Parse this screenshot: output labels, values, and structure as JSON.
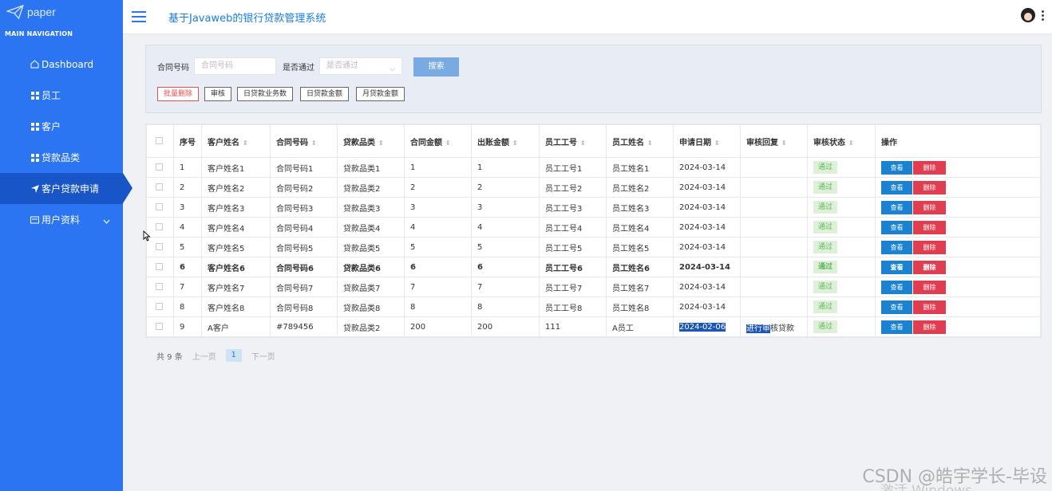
{
  "sidebar": {
    "logo_text": "paper",
    "nav_header": "MAIN NAVIGATION",
    "items": [
      {
        "label": "Dashboard"
      },
      {
        "label": "员工"
      },
      {
        "label": "客户"
      },
      {
        "label": "贷款品类"
      },
      {
        "label": "客户贷款申请"
      },
      {
        "label": "用户资料"
      }
    ]
  },
  "header": {
    "title": "基于Javaweb的银行贷款管理系统"
  },
  "search": {
    "contract_label": "合同号码",
    "contract_placeholder": "合同号码",
    "passed_label": "是否通过",
    "passed_placeholder": "是否通过",
    "search_button": "搜索"
  },
  "actions": {
    "batch_delete": "批量删除",
    "review": "审核",
    "daily_count": "日贷款业务数",
    "daily_amount": "日贷款金额",
    "monthly_amount": "月贷款金额"
  },
  "table": {
    "headers": [
      "序号",
      "客户姓名",
      "合同号码",
      "贷款品类",
      "合同金额",
      "出账金额",
      "员工工号",
      "员工姓名",
      "申请日期",
      "审核回复",
      "审核状态",
      "操作"
    ],
    "rows": [
      {
        "no": "1",
        "customer": "客户姓名1",
        "contract": "合同号码1",
        "category": "贷款品类1",
        "amount": "1",
        "out": "1",
        "emp_no": "员工工号1",
        "emp_name": "员工姓名1",
        "date": "2024-03-14",
        "reply": "",
        "status": "通过"
      },
      {
        "no": "2",
        "customer": "客户姓名2",
        "contract": "合同号码2",
        "category": "贷款品类2",
        "amount": "2",
        "out": "2",
        "emp_no": "员工工号2",
        "emp_name": "员工姓名2",
        "date": "2024-03-14",
        "reply": "",
        "status": "通过"
      },
      {
        "no": "3",
        "customer": "客户姓名3",
        "contract": "合同号码3",
        "category": "贷款品类3",
        "amount": "3",
        "out": "3",
        "emp_no": "员工工号3",
        "emp_name": "员工姓名3",
        "date": "2024-03-14",
        "reply": "",
        "status": "通过"
      },
      {
        "no": "4",
        "customer": "客户姓名4",
        "contract": "合同号码4",
        "category": "贷款品类4",
        "amount": "4",
        "out": "4",
        "emp_no": "员工工号4",
        "emp_name": "员工姓名4",
        "date": "2024-03-14",
        "reply": "",
        "status": "通过"
      },
      {
        "no": "5",
        "customer": "客户姓名5",
        "contract": "合同号码5",
        "category": "贷款品类5",
        "amount": "5",
        "out": "5",
        "emp_no": "员工工号5",
        "emp_name": "员工姓名5",
        "date": "2024-03-14",
        "reply": "",
        "status": "通过"
      },
      {
        "no": "6",
        "customer": "客户姓名6",
        "contract": "合同号码6",
        "category": "贷款品类6",
        "amount": "6",
        "out": "6",
        "emp_no": "员工工号6",
        "emp_name": "员工姓名6",
        "date": "2024-03-14",
        "reply": "",
        "status": "通过"
      },
      {
        "no": "7",
        "customer": "客户姓名7",
        "contract": "合同号码7",
        "category": "贷款品类7",
        "amount": "7",
        "out": "7",
        "emp_no": "员工工号7",
        "emp_name": "员工姓名7",
        "date": "2024-03-14",
        "reply": "",
        "status": "通过"
      },
      {
        "no": "8",
        "customer": "客户姓名8",
        "contract": "合同号码8",
        "category": "贷款品类8",
        "amount": "8",
        "out": "8",
        "emp_no": "员工工号8",
        "emp_name": "员工姓名8",
        "date": "2024-03-14",
        "reply": "",
        "status": "通过"
      },
      {
        "no": "9",
        "customer": "A客户",
        "contract": "#789456",
        "category": "贷款品类2",
        "amount": "200",
        "out": "200",
        "emp_no": "111",
        "emp_name": "A员工",
        "date": "2024-02-06",
        "reply": "进行审核贷款",
        "status": "通过"
      }
    ],
    "view_label": "查看",
    "delete_label": "删除"
  },
  "pager": {
    "total": "共 9 条",
    "prev": "上一页",
    "current": "1",
    "next": "下一页"
  },
  "watermark": "CSDN @皓宇学长-毕设",
  "watermark2": "激活 Windows",
  "colors": {
    "sidebar": "#2b74f2",
    "active": "#1856c8",
    "view_button": "#1b82d1",
    "delete_button": "#e03d50",
    "status_badge_bg": "#dff0d8"
  }
}
